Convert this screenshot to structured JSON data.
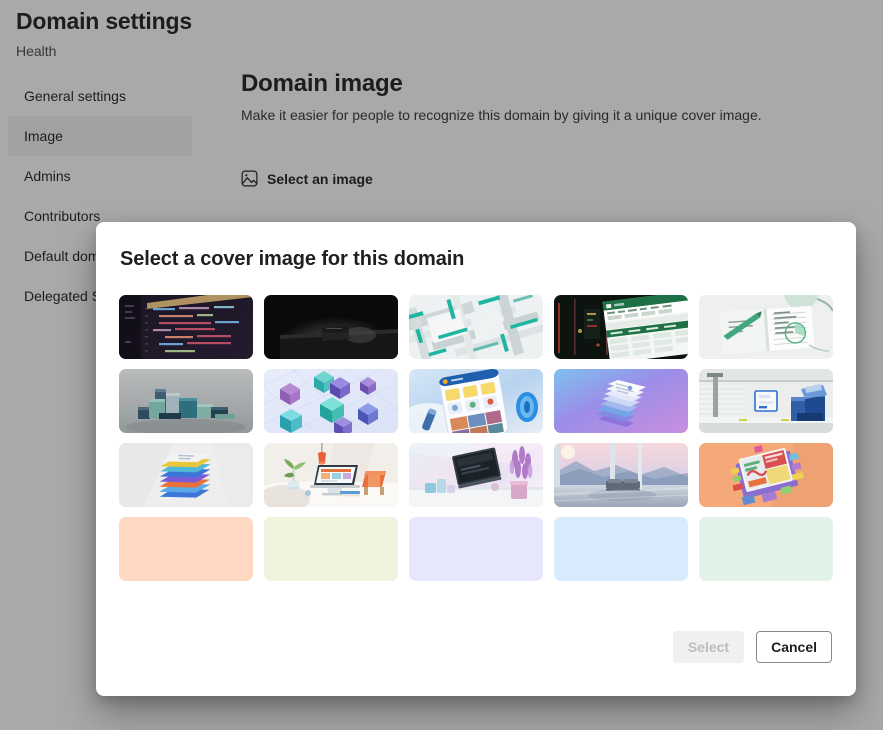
{
  "page": {
    "title": "Domain settings",
    "subtitle": "Health"
  },
  "sidebar": {
    "items": [
      {
        "label": "General settings",
        "selected": false
      },
      {
        "label": "Image",
        "selected": true
      },
      {
        "label": "Admins",
        "selected": false
      },
      {
        "label": "Contributors",
        "selected": false
      },
      {
        "label": "Default domain image",
        "selected": false
      },
      {
        "label": "Delegated Settings",
        "selected": false
      }
    ]
  },
  "main": {
    "heading": "Domain image",
    "description": "Make it easier for people to recognize this domain by giving it a unique cover image.",
    "select_image_label": "Select an image",
    "select_image_icon": "picture-icon"
  },
  "dialog": {
    "title": "Select a cover image for this domain",
    "buttons": {
      "select": "Select",
      "select_disabled": true,
      "cancel": "Cancel"
    },
    "thumbnails": [
      {
        "id": "code-editor-dark",
        "alt": "Dark code editor on a monitor",
        "kind": "photo"
      },
      {
        "id": "dark-laptop-desk",
        "alt": "Laptop glowing on a dark desk",
        "kind": "photo"
      },
      {
        "id": "teal-abstract-blocks",
        "alt": "Abstract teal and white block pattern",
        "kind": "photo"
      },
      {
        "id": "spreadsheet-dark",
        "alt": "Spreadsheet app on dark background",
        "kind": "photo"
      },
      {
        "id": "open-notebook-green",
        "alt": "Open notebook with pen, green tint",
        "kind": "photo"
      },
      {
        "id": "teal-3d-boxes",
        "alt": "3D teal and navy boxes on grey",
        "kind": "photo"
      },
      {
        "id": "purple-glass-cubes",
        "alt": "Purple and teal glass cubes",
        "kind": "photo"
      },
      {
        "id": "phone-app-blue",
        "alt": "Phone showing app on blue gradient",
        "kind": "photo"
      },
      {
        "id": "stacked-cards-purple",
        "alt": "Stacked cards on purple gradient",
        "kind": "photo"
      },
      {
        "id": "office-shelf-blue",
        "alt": "Blue office items on a shelf",
        "kind": "photo"
      },
      {
        "id": "stacked-papers",
        "alt": "Colorful stack of documents",
        "kind": "photo"
      },
      {
        "id": "desk-workspace",
        "alt": "Desk workspace with laptop and plant",
        "kind": "photo"
      },
      {
        "id": "tablet-lavender",
        "alt": "Tablet beside lavender plant",
        "kind": "photo"
      },
      {
        "id": "sunset-landscape",
        "alt": "Pastel sunset landscape with sofa",
        "kind": "photo"
      },
      {
        "id": "orange-collage",
        "alt": "Illustration collage on orange",
        "kind": "photo"
      },
      {
        "id": "swatch-peach",
        "alt": "Peach solid color",
        "kind": "swatch",
        "color": "#ffd8c2"
      },
      {
        "id": "swatch-lime",
        "alt": "Pale lime solid color",
        "kind": "swatch",
        "color": "#edf3dd"
      },
      {
        "id": "swatch-lavender",
        "alt": "Lavender solid color",
        "kind": "swatch",
        "color": "#e6e6fc"
      },
      {
        "id": "swatch-sky",
        "alt": "Sky blue solid color",
        "kind": "swatch",
        "color": "#d8eafd"
      },
      {
        "id": "swatch-mint",
        "alt": "Mint solid color",
        "kind": "swatch",
        "color": "#e1f3e8"
      }
    ]
  },
  "colors": {
    "page_background": "#b0b0b0",
    "nav_selected": "#a8a8a8",
    "dialog_background": "#ffffff",
    "text_primary": "#1f1f1f",
    "button_disabled_bg": "#f0f0f0",
    "button_disabled_text": "#bdbdbd",
    "button_border": "#8a8a8a"
  }
}
